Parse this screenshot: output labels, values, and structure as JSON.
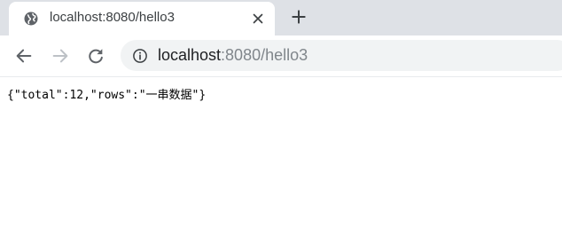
{
  "browser": {
    "tab": {
      "title": "localhost:8080/hello3",
      "favicon_icon": "globe-icon",
      "close_icon": "close-icon"
    },
    "new_tab_icon": "plus-icon",
    "toolbar": {
      "back_icon": "arrow-left-icon",
      "forward_icon": "arrow-right-icon",
      "reload_icon": "reload-icon",
      "site_info_icon": "info-icon"
    },
    "address": {
      "host": "localhost",
      "rest": ":8080/hello3"
    }
  },
  "page": {
    "body_text": "{\"total\":12,\"rows\":\"一串数据\"}"
  },
  "colors": {
    "tabstrip_bg": "#dee1e6",
    "omnibox_bg": "#f1f3f4",
    "icon": "#5f6368",
    "icon_disabled": "#bdc1c6"
  }
}
